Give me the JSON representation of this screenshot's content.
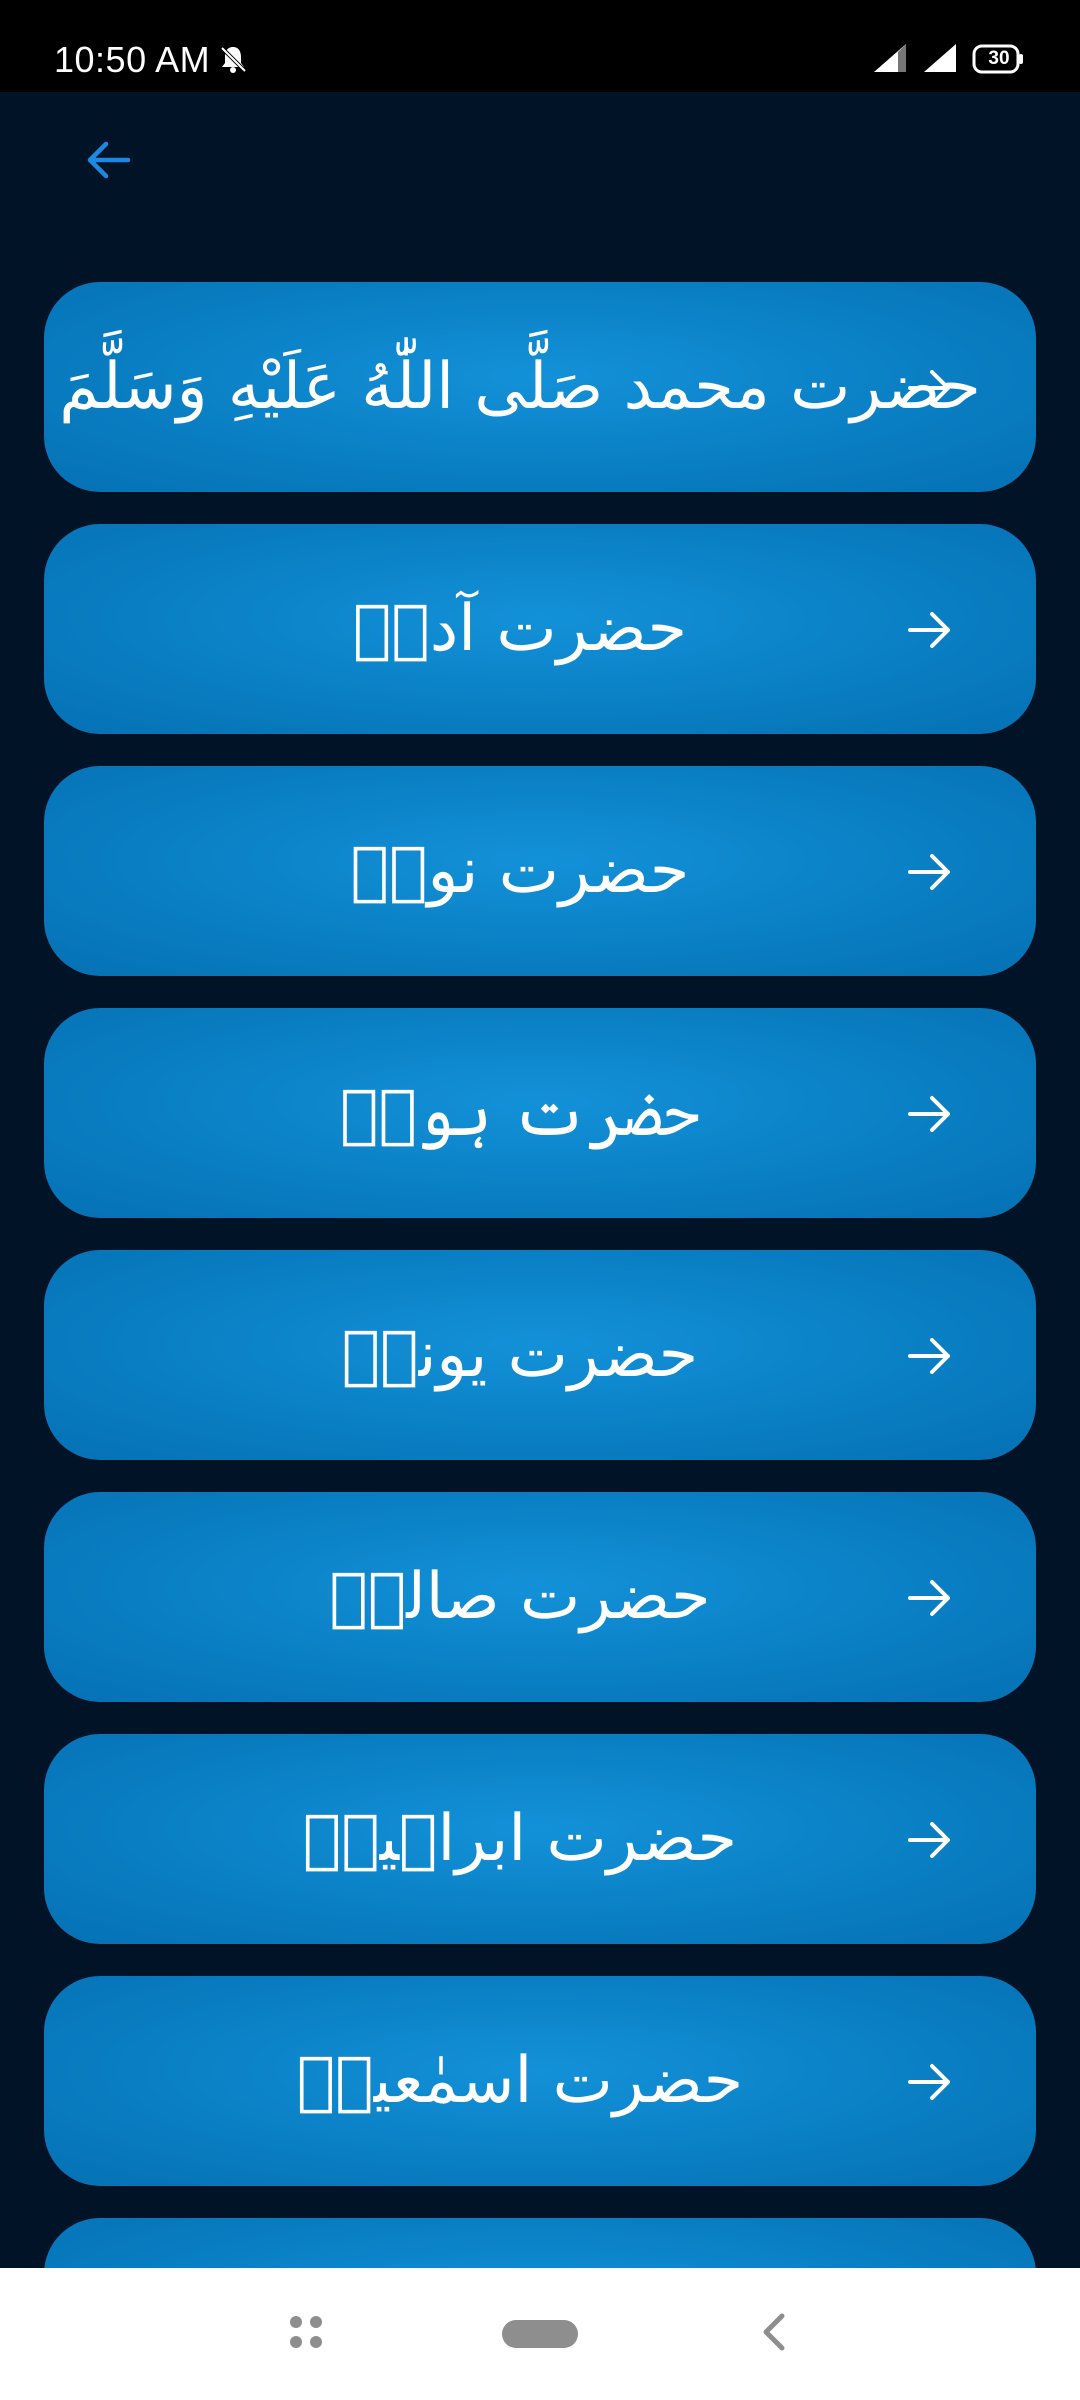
{
  "status_bar": {
    "time": "10:50 AM",
    "battery": "30",
    "icons": [
      "bell-off-icon",
      "signal-icon",
      "signal-icon",
      "battery-icon"
    ]
  },
  "header": {
    "back_icon": "arrow-left-icon"
  },
  "colors": {
    "background": "#011427",
    "card": "#0a7fc4",
    "accent": "#1e88e5"
  },
  "prophets": [
    {
      "label": "حضرت محمد صَلَّى اللّٰهُ عَلَيْهِ وَسَلَّمَ"
    },
    {
      "label": "حضرت آدمؑ"
    },
    {
      "label": "حضرت نوحؑ"
    },
    {
      "label": "حضرت ہودؑ"
    },
    {
      "label": "حضرت یونسؑ"
    },
    {
      "label": "حضرت صالحؑ"
    },
    {
      "label": "حضرت ابراہیمؑ"
    },
    {
      "label": "حضرت اسمٰعیلؑ"
    },
    {
      "label": ""
    }
  ],
  "nav_bar": {
    "icons": [
      "recent-apps-icon",
      "home-pill-icon",
      "nav-back-icon"
    ]
  }
}
